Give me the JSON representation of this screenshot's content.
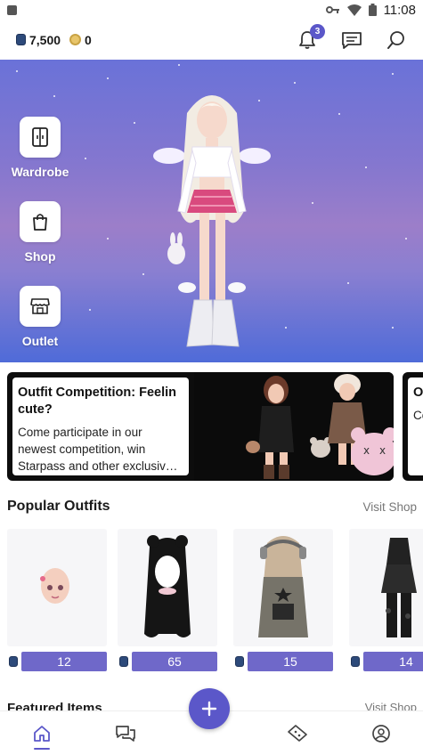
{
  "status_bar": {
    "time": "11:08"
  },
  "header": {
    "gems": "7,500",
    "coins": "0",
    "notification_count": "3"
  },
  "hero": {
    "buttons": [
      {
        "label": "Wardrobe",
        "icon": "wardrobe-icon"
      },
      {
        "label": "Shop",
        "icon": "shopping-bag-icon"
      },
      {
        "label": "Outlet",
        "icon": "storefront-icon"
      }
    ]
  },
  "competitions": [
    {
      "title": "Outfit Competition: Feelin cute?",
      "description": "Come participate in our newest competition, win Starpass and other exclusiv…"
    },
    {
      "title": "O T",
      "description": "Co ne St"
    }
  ],
  "popular_outfits": {
    "title": "Popular Outfits",
    "link": "Visit Shop",
    "items": [
      {
        "price": "12"
      },
      {
        "price": "65"
      },
      {
        "price": "15"
      },
      {
        "price": "14"
      }
    ]
  },
  "featured_items": {
    "title": "Featured Items",
    "link": "Visit Shop"
  },
  "bottom_nav": {
    "items": [
      {
        "icon": "home-icon",
        "active": true
      },
      {
        "icon": "chat-bubbles-icon",
        "active": false
      },
      {
        "icon": "fab-plus-icon",
        "active": false
      },
      {
        "icon": "tickets-icon",
        "active": false
      },
      {
        "icon": "profile-icon",
        "active": false
      }
    ]
  },
  "colors": {
    "accent": "#5b57c9",
    "price_bar": "#6f68c9",
    "hero_top": "#6a72d8",
    "hero_bottom": "#4f6bd8"
  }
}
